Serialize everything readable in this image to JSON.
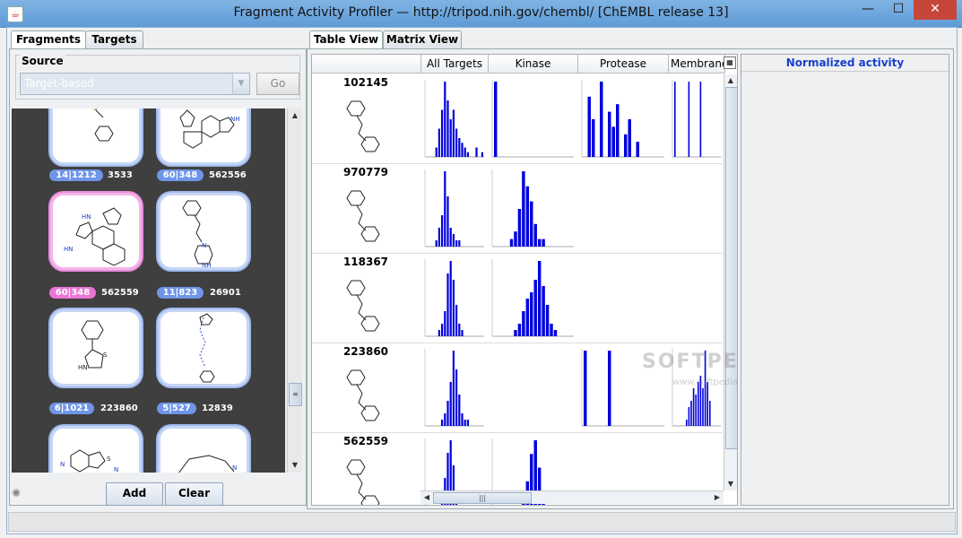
{
  "window": {
    "title": "Fragment Activity Profiler — http://tripod.nih.gov/chembl/ [ChEMBL release 13]"
  },
  "left_tabs": [
    "Fragments",
    "Targets"
  ],
  "source": {
    "label": "Source",
    "combo_value": "Target-based",
    "go_label": "Go"
  },
  "fragments": [
    {
      "badge": "14|1212",
      "id": "3533",
      "highlight": false
    },
    {
      "badge": "60|348",
      "id": "562556",
      "highlight": false
    },
    {
      "badge": "60|348",
      "id": "562559",
      "highlight": true
    },
    {
      "badge": "11|823",
      "id": "26901",
      "highlight": false
    },
    {
      "badge": "6|1021",
      "id": "223860",
      "highlight": false
    },
    {
      "badge": "5|527",
      "id": "12839",
      "highlight": false
    }
  ],
  "buttons": {
    "add": "Add",
    "clear": "Clear"
  },
  "right_tabs": [
    "Table View",
    "Matrix View"
  ],
  "columns": [
    "All Targets",
    "Kinase",
    "Protease",
    "Membrane"
  ],
  "rows": [
    {
      "id": "102145"
    },
    {
      "id": "970779"
    },
    {
      "id": "118367"
    },
    {
      "id": "223860"
    },
    {
      "id": "562559"
    }
  ],
  "normalized_title": "Normalized activity",
  "watermark": {
    "text": "SOFTPEDIA",
    "url": "www.softpedia.com"
  },
  "colors": {
    "bar": "#0000dd",
    "badge": "#6f95e8",
    "badge_highlight": "#ec74d6"
  }
}
